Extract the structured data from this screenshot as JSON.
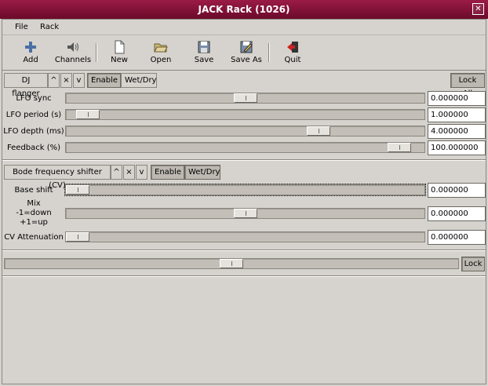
{
  "window": {
    "title": "JACK Rack (1026)"
  },
  "titlebar": {
    "close_glyph": "✕"
  },
  "menu": {
    "file": "File",
    "rack": "Rack"
  },
  "toolbar": {
    "add": "Add",
    "channels": "Channels",
    "new": "New",
    "open": "Open",
    "save": "Save",
    "save_as": "Save As",
    "quit": "Quit"
  },
  "glyphs": {
    "up": "^",
    "close": "×",
    "down": "v"
  },
  "plugin1": {
    "name": "DJ flanger",
    "enable": "Enable",
    "wetdry": "Wet/Dry",
    "lock_all": "Lock All",
    "rows": [
      {
        "label": "LFO sync",
        "value": "0.000000",
        "slider": 0.5
      },
      {
        "label": "LFO period (s)",
        "value": "1.000000",
        "slider": 0.03
      },
      {
        "label": "LFO depth (ms)",
        "value": "4.000000",
        "slider": 0.72
      },
      {
        "label": "Feedback (%)",
        "value": "100.000000",
        "slider": 0.96
      }
    ]
  },
  "plugin2": {
    "name": "Bode frequency shifter (CV)",
    "enable": "Enable",
    "wetdry": "Wet/Dry",
    "rows": [
      {
        "label": "Base shift",
        "value": "0.000000",
        "slider": 0.0
      },
      {
        "label_lines": [
          "Mix",
          "-1=down",
          "+1=up"
        ],
        "value": "0.000000",
        "slider": 0.5
      },
      {
        "label": "CV Attenuation",
        "value": "0.000000",
        "slider": 0.0
      }
    ],
    "wetdry_slider": 0.5,
    "lock": "Lock"
  }
}
